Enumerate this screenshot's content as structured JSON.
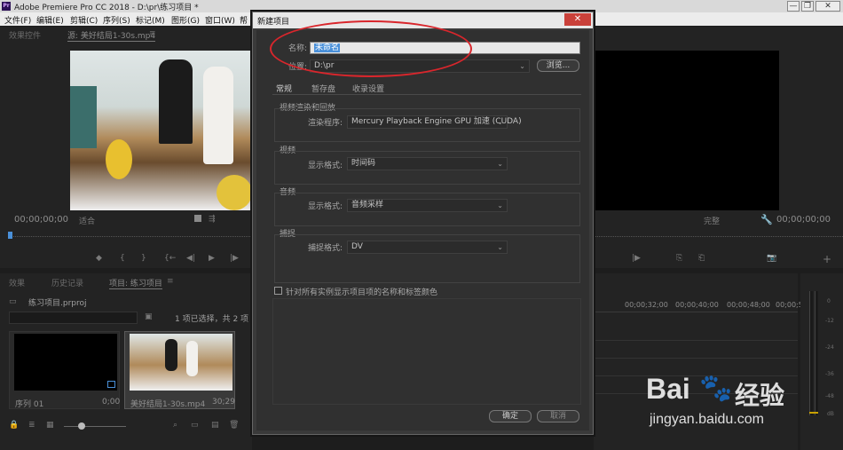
{
  "app": {
    "title": "Adobe Premiere Pro CC 2018 - D:\\pr\\练习项目 *",
    "logo": "Pr",
    "window_buttons": [
      "—",
      "❐",
      "✕"
    ]
  },
  "menu": [
    "文件(F)",
    "编辑(E)",
    "剪辑(C)",
    "序列(S)",
    "标记(M)",
    "图形(G)",
    "窗口(W)",
    "帮"
  ],
  "source_panel": {
    "tabs": [
      "效果控件",
      "源: 美好结局1-30s.mp4",
      "≡"
    ],
    "timecode": "00;00;00;00",
    "fit": "适合",
    "transport": [
      "◆",
      "{",
      "}",
      "{←",
      "◀|",
      "▶",
      "|▶",
      "→}"
    ]
  },
  "program_panel": {
    "quality": "完整",
    "timecode": "00;00;00;00",
    "transport": [
      "|▶",
      "⎘",
      "⎗",
      "📷",
      "+"
    ]
  },
  "project_panel": {
    "tabs": [
      "效果",
      "历史记录",
      "项目: 练习项目",
      "≡"
    ],
    "project_file": "练习项目.prproj",
    "selection_info": "1 项已选择，共 2 项",
    "items": [
      {
        "name": "序列 01",
        "duration": "0;00"
      },
      {
        "name": "美好结局1-30s.mp4",
        "duration": "30;29"
      }
    ]
  },
  "timeline": {
    "ruler": [
      "00;00;32;00",
      "00;00;40;00",
      "00;00;48;00",
      "00;00;5"
    ]
  },
  "audio_meter": {
    "ticks": [
      "0",
      "-12",
      "-24",
      "-36",
      "-48",
      "dB"
    ]
  },
  "dialog": {
    "title": "新建项目",
    "close": "✕",
    "name_label": "名称:",
    "name_value": "未命名",
    "location_label": "位置:",
    "location_value": "D:\\pr",
    "browse": "浏览...",
    "tabs": [
      "常规",
      "暂存盘",
      "收录设置"
    ],
    "video_rendering": {
      "header": "视频渲染和回放",
      "label": "渲染程序:",
      "value": "Mercury Playback Engine GPU 加速 (CUDA)"
    },
    "video": {
      "header": "视频",
      "label": "显示格式:",
      "value": "时间码"
    },
    "audio": {
      "header": "音频",
      "label": "显示格式:",
      "value": "音频采样"
    },
    "capture": {
      "header": "捕捉",
      "label": "捕捉格式:",
      "value": "DV"
    },
    "checkbox_label": "针对所有实例显示项目项的名称和标签颜色",
    "ok": "确定",
    "cancel": "取消"
  },
  "watermark": {
    "brand": "Bai",
    "brand_suffix": "经验",
    "url": "jingyan.baidu.com"
  },
  "colors": {
    "highlight_ellipse": "#d9262c",
    "selection_blue": "#4a90d9",
    "close_red": "#c9413a"
  }
}
